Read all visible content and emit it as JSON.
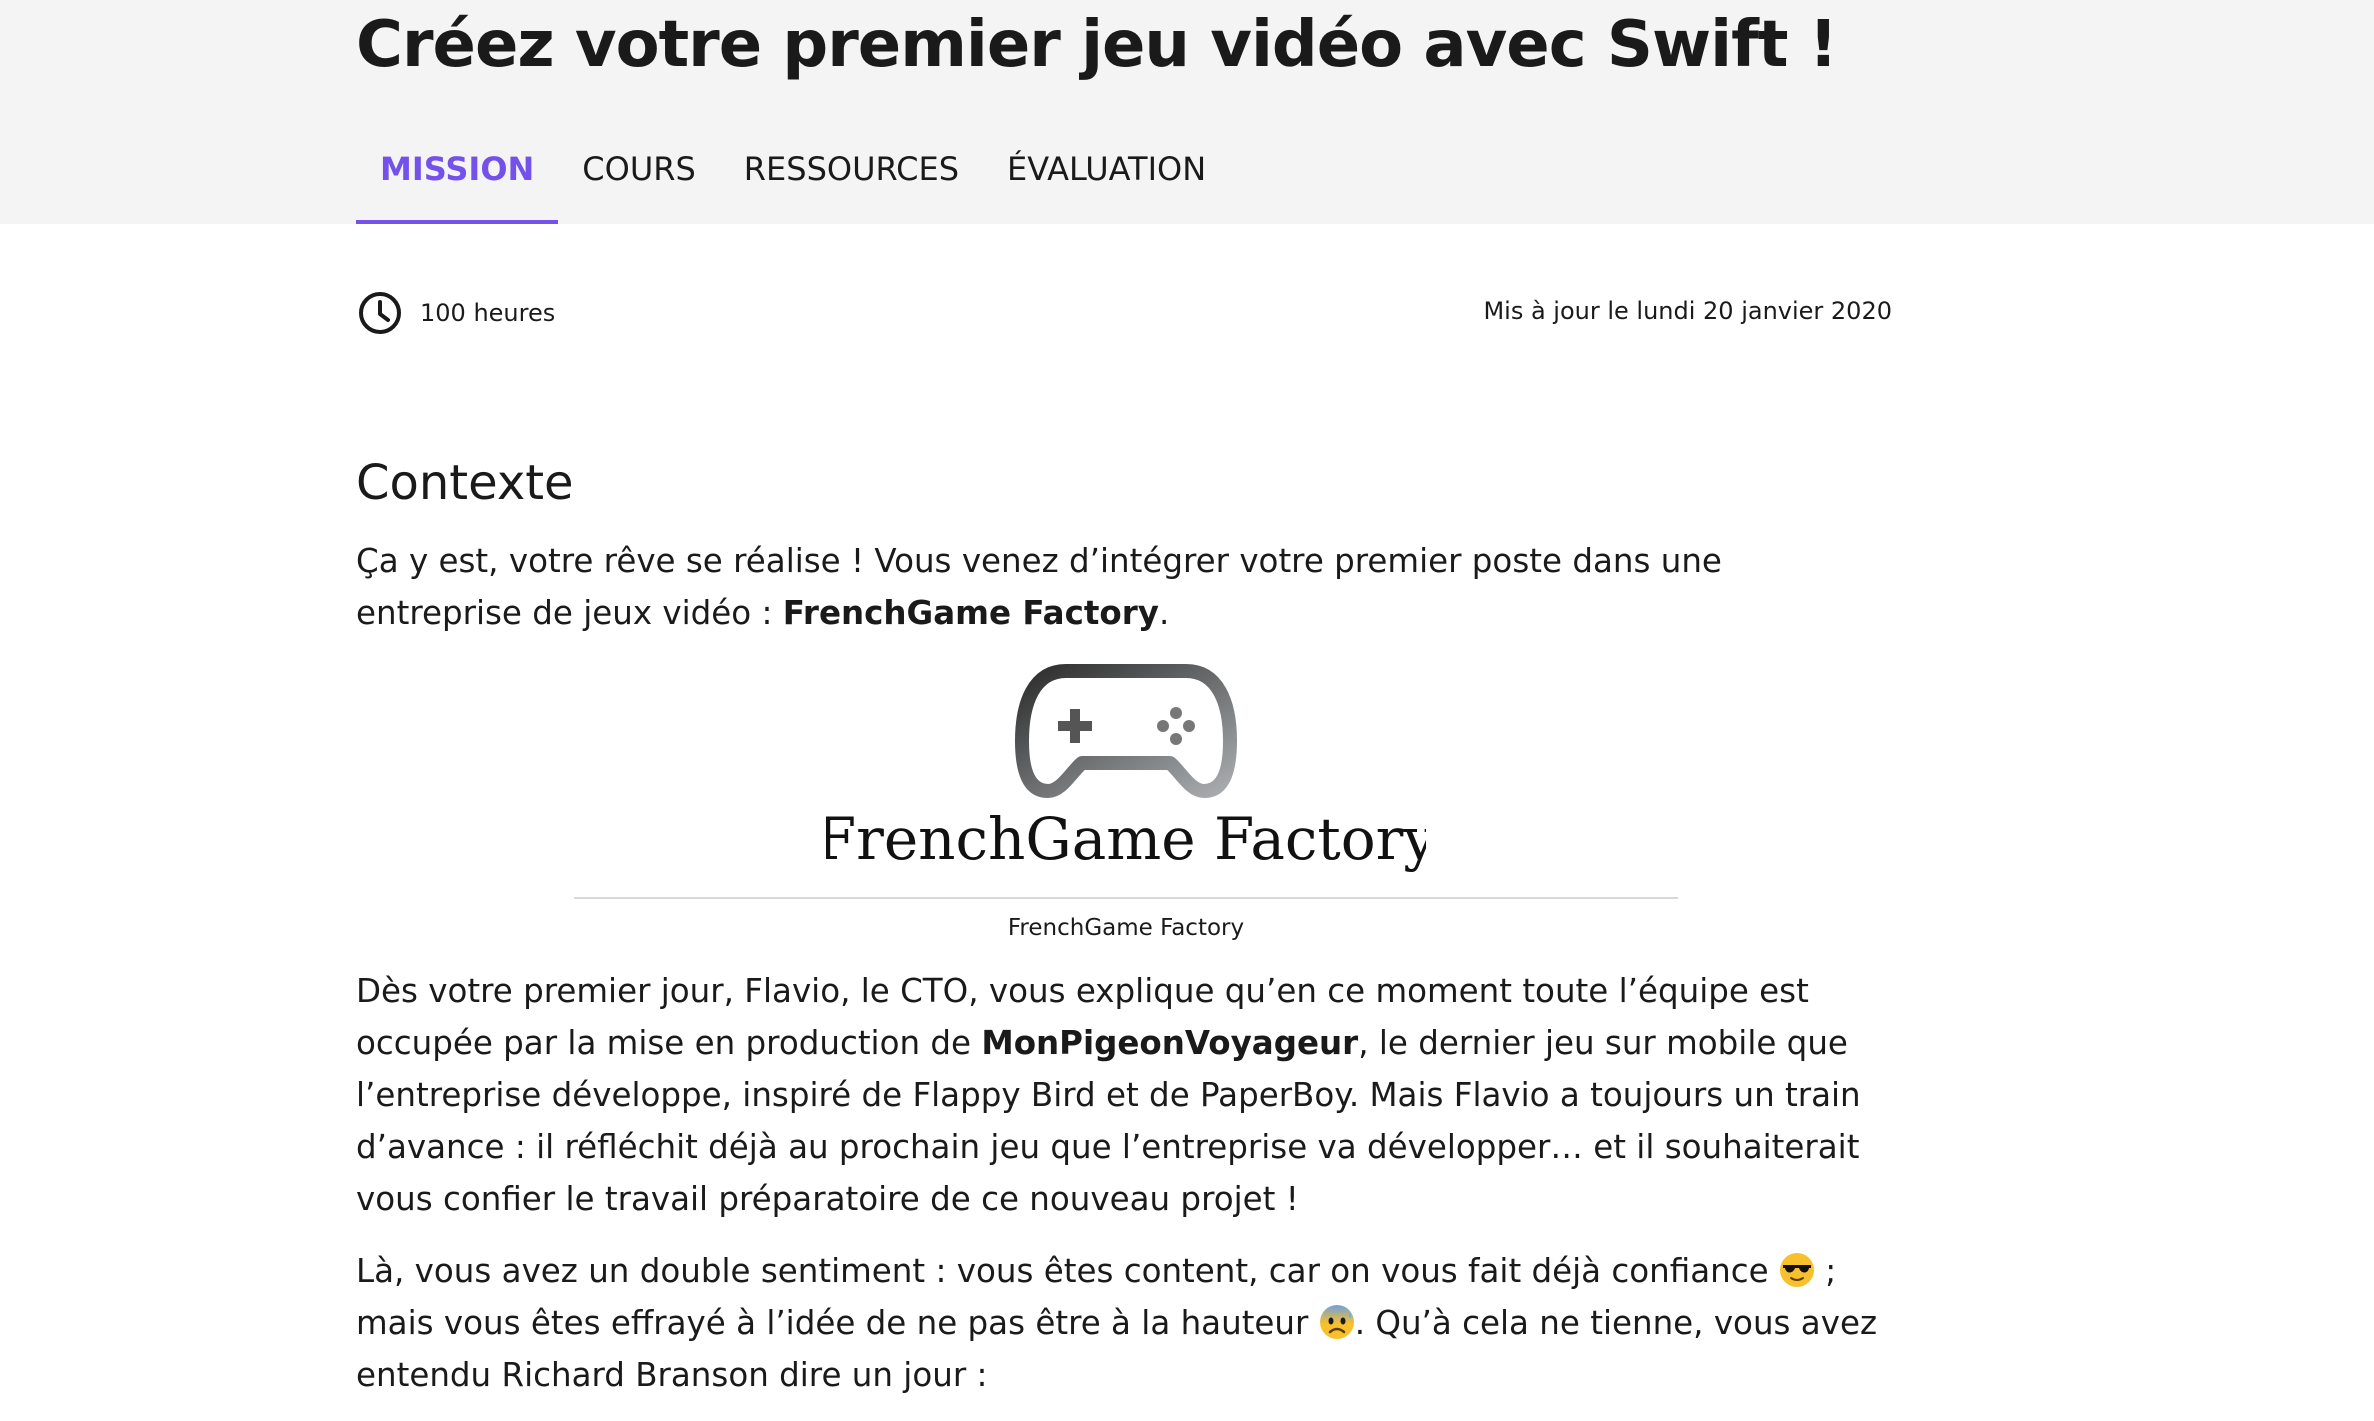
{
  "header": {
    "title": "Créez votre premier jeu vidéo avec Swift !",
    "tabs": [
      {
        "label": "MISSION",
        "active": true
      },
      {
        "label": "COURS",
        "active": false
      },
      {
        "label": "RESSOURCES",
        "active": false
      },
      {
        "label": "ÉVALUATION",
        "active": false
      }
    ]
  },
  "meta": {
    "duration": "100 heures",
    "duration_icon": "clock-icon",
    "updated": "Mis à jour le lundi 20 janvier 2020"
  },
  "content": {
    "heading": "Contexte",
    "p1": {
      "before": "Ça y est, votre rêve se réalise ! Vous venez d’intégrer votre premier poste dans une entreprise de jeux vidéo : ",
      "bold": "FrenchGame Factory",
      "after": "."
    },
    "figure": {
      "logo_text": "FrenchGame Factory",
      "logo_icon": "gamepad-icon",
      "caption": "FrenchGame Factory"
    },
    "p2": {
      "before": "Dès votre premier jour, Flavio, le CTO, vous explique qu’en ce moment toute l’équipe est occupée par la mise en production de ",
      "bold": "MonPigeonVoyageur",
      "after": ", le dernier jeu sur mobile que l’entreprise développe, inspiré de Flappy Bird et de PaperBoy. Mais Flavio a toujours un train d’avance : il réfléchit déjà au prochain jeu que l’entreprise va développer… et il souhaiterait vous confier le travail préparatoire de ce nouveau projet !"
    },
    "p3": {
      "part1": "Là, vous avez un double sentiment : vous êtes content, car on vous fait déjà confiance ",
      "emoji1": "sunglasses-emoji",
      "part2": " ; mais vous êtes effrayé à l’idée de ne pas être à la hauteur ",
      "emoji2": "anxious-face-emoji",
      "part3": ". Qu’à cela ne tienne, vous avez entendu Richard Branson dire un jour :"
    }
  },
  "colors": {
    "accent": "#7451eb",
    "header_bg": "#f4f4f4",
    "text": "#1a1a1a"
  }
}
